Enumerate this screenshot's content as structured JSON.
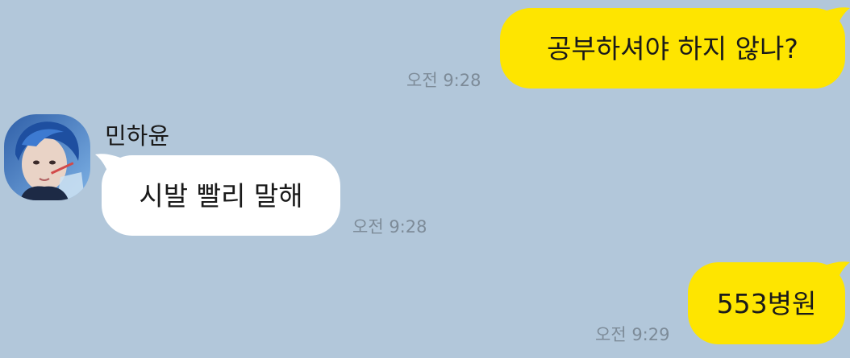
{
  "theme": {
    "background": "#b2c7da",
    "my_bubble": "#fee500",
    "their_bubble": "#ffffff",
    "timestamp_color": "#7d8b98"
  },
  "messages": [
    {
      "sender": "me",
      "text": "공부하셔야 하지 않나?",
      "time": "오전 9:28"
    },
    {
      "sender": "민하윤",
      "text": "시발 빨리 말해",
      "time": "오전 9:28"
    },
    {
      "sender": "me",
      "text": "553병원",
      "time": "오전 9:29"
    }
  ],
  "contact": {
    "name": "민하윤",
    "avatar_icon": "profile-photo-avatar"
  }
}
